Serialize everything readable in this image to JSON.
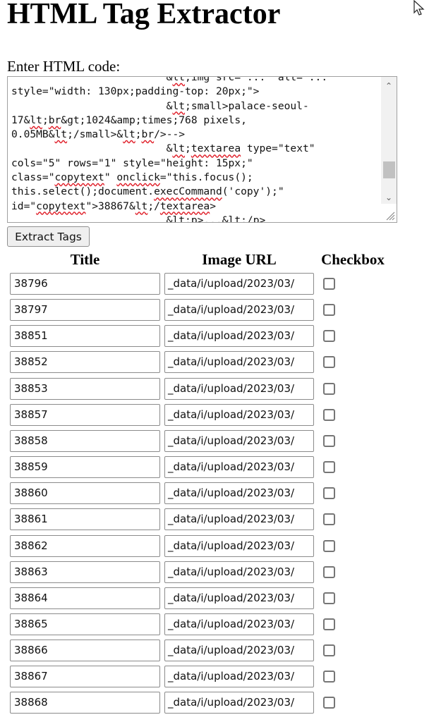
{
  "page": {
    "title": "HTML Tag Extractor",
    "input_label": "Enter HTML code:"
  },
  "code_input": {
    "lines": [
      "                         <img src=\"...\" alt=\"...\"",
      "style=\"width: 130px;padding-top: 20px;\">",
      "                         <small>palace-seoul-",
      "17&lt;br&gt;1024&amp;times;768 pixels,",
      "0.05MB</small><br/>-->",
      "                         <textarea type=\"text\"",
      "cols=\"5\" rows=\"1\" style=\"height: 15px;\"",
      "class=\"copytext\" onclick=\"this.focus();",
      "this.select();document.execCommand('copy');\"",
      "id=\"copytext\">38867</textarea>",
      "                         <p>...</p>"
    ]
  },
  "extract_button": {
    "label": "Extract Tags"
  },
  "table": {
    "headers": {
      "title": "Title",
      "url": "Image URL",
      "checkbox": "Checkbox"
    },
    "rows": [
      {
        "title": "38796",
        "url": "_data/i/upload/2023/03/",
        "checked": false
      },
      {
        "title": "38797",
        "url": "_data/i/upload/2023/03/",
        "checked": false
      },
      {
        "title": "38851",
        "url": "_data/i/upload/2023/03/",
        "checked": false
      },
      {
        "title": "38852",
        "url": "_data/i/upload/2023/03/",
        "checked": false
      },
      {
        "title": "38853",
        "url": "_data/i/upload/2023/03/",
        "checked": false
      },
      {
        "title": "38857",
        "url": "_data/i/upload/2023/03/",
        "checked": false
      },
      {
        "title": "38858",
        "url": "_data/i/upload/2023/03/",
        "checked": false
      },
      {
        "title": "38859",
        "url": "_data/i/upload/2023/03/",
        "checked": false
      },
      {
        "title": "38860",
        "url": "_data/i/upload/2023/03/",
        "checked": false
      },
      {
        "title": "38861",
        "url": "_data/i/upload/2023/03/",
        "checked": false
      },
      {
        "title": "38862",
        "url": "_data/i/upload/2023/03/",
        "checked": false
      },
      {
        "title": "38863",
        "url": "_data/i/upload/2023/03/",
        "checked": false
      },
      {
        "title": "38864",
        "url": "_data/i/upload/2023/03/",
        "checked": false
      },
      {
        "title": "38865",
        "url": "_data/i/upload/2023/03/",
        "checked": false
      },
      {
        "title": "38866",
        "url": "_data/i/upload/2023/03/",
        "checked": false
      },
      {
        "title": "38867",
        "url": "_data/i/upload/2023/03/",
        "checked": false
      },
      {
        "title": "38868",
        "url": "_data/i/upload/2023/03/",
        "checked": false
      }
    ]
  },
  "icons": {
    "cursor": "mouse-pointer-icon",
    "scroll_up": "chevron-up-icon",
    "scroll_down": "chevron-down-icon",
    "resize": "resize-grip-icon"
  }
}
